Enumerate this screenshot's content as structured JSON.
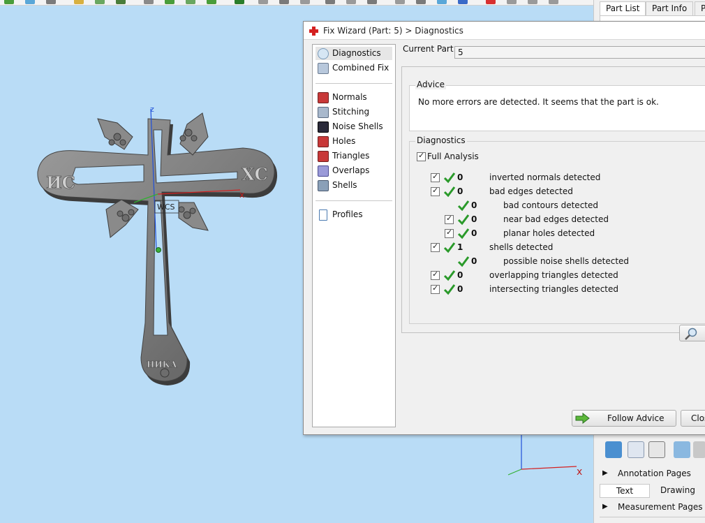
{
  "dock": {
    "tabs": [
      "Part List",
      "Part Info",
      "Pa"
    ],
    "annotation_pages": "Annotation Pages",
    "text_tab": "Text",
    "drawing_tab": "Drawing",
    "measurement_pages": "Measurement Pages"
  },
  "viewport": {
    "axis_z": "z",
    "axis_x": "x",
    "wcs_label": "WCS",
    "engraving_left": "ИС",
    "engraving_right": "ХС",
    "engraving_bottom": "НИКА"
  },
  "dialog": {
    "title": "Fix Wizard (Part: 5) > Diagnostics",
    "current_part_label": "Current Part:",
    "current_part_value": "5",
    "nav": {
      "top": [
        "Diagnostics",
        "Combined Fix"
      ],
      "middle": [
        "Normals",
        "Stitching",
        "Noise Shells",
        "Holes",
        "Triangles",
        "Overlaps",
        "Shells"
      ],
      "bottom": [
        "Profiles"
      ]
    },
    "advice": {
      "title": "Advice",
      "text": "No more errors are detected. It seems that the part is ok."
    },
    "diagnostics": {
      "title": "Diagnostics",
      "full_analysis": "Full Analysis",
      "rows": [
        {
          "count": "0",
          "label": "inverted normals detected"
        },
        {
          "count": "0",
          "label": "bad edges detected"
        },
        {
          "count": "0",
          "label": "bad contours detected"
        },
        {
          "count": "0",
          "label": "near bad edges detected"
        },
        {
          "count": "0",
          "label": "planar holes detected"
        },
        {
          "count": "1",
          "label": "shells detected"
        },
        {
          "count": "0",
          "label": "possible noise shells detected"
        },
        {
          "count": "0",
          "label": "overlapping triangles detected"
        },
        {
          "count": "0",
          "label": "intersecting triangles detected"
        }
      ]
    },
    "follow_advice": "Follow Advice",
    "close": "Clos"
  },
  "colors": {
    "viewport_bg": "#b9dcf6",
    "check_green": "#2a9a2a",
    "axis_red": "#d42020",
    "axis_blue": "#2050d8"
  }
}
